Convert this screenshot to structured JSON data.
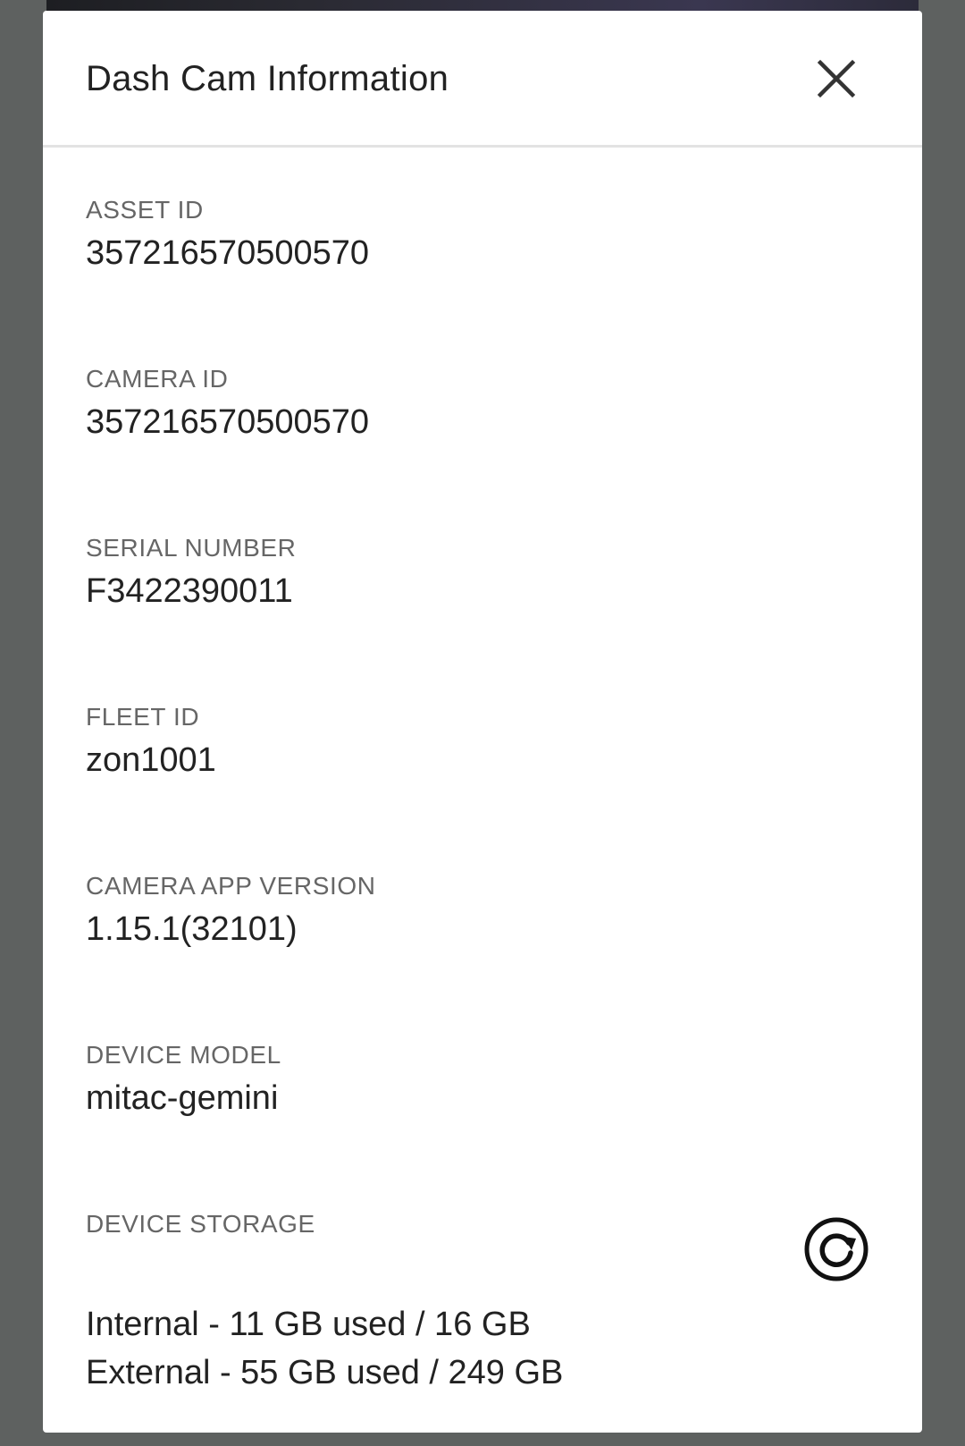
{
  "dialog": {
    "title": "Dash Cam Information"
  },
  "fields": {
    "asset_id": {
      "label": "ASSET ID",
      "value": "357216570500570"
    },
    "camera_id": {
      "label": "CAMERA ID",
      "value": "357216570500570"
    },
    "serial_number": {
      "label": "SERIAL NUMBER",
      "value": "F3422390011"
    },
    "fleet_id": {
      "label": "FLEET ID",
      "value": "zon1001"
    },
    "camera_app_version": {
      "label": "CAMERA APP VERSION",
      "value": "1.15.1(32101)"
    },
    "device_model": {
      "label": "DEVICE MODEL",
      "value": "mitac-gemini"
    }
  },
  "storage": {
    "label": "DEVICE STORAGE",
    "internal": "Internal - 11 GB used / 16 GB",
    "external": "External - 55 GB used / 249 GB"
  },
  "icons": {
    "close": "close-icon",
    "refresh": "refresh-icon"
  }
}
